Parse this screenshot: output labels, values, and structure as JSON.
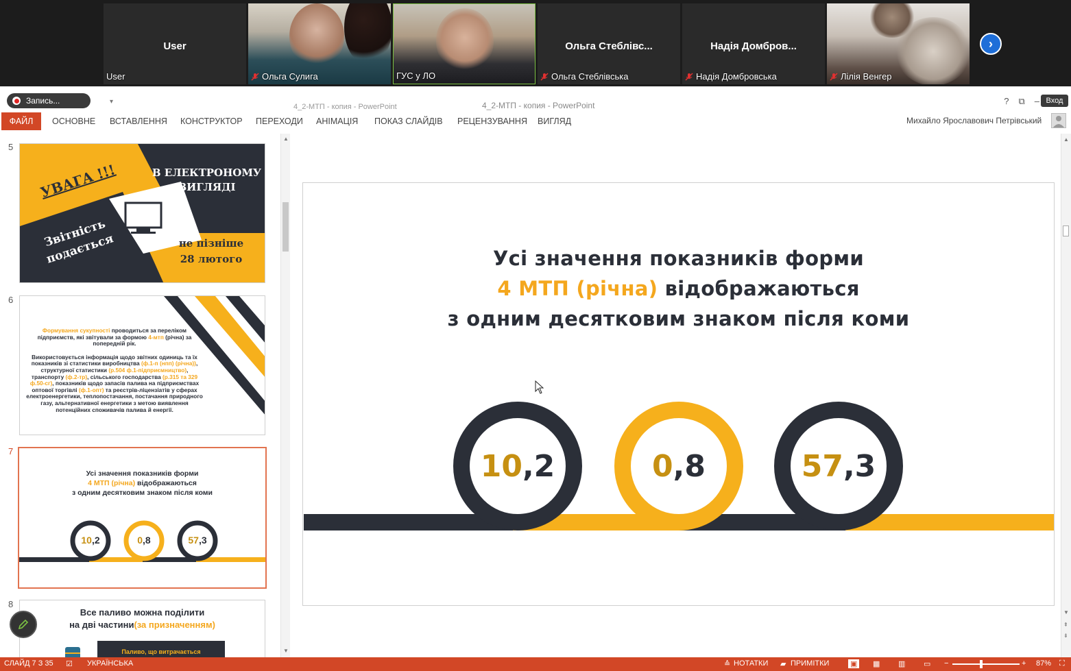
{
  "video_strip": {
    "participants": [
      {
        "center_name": "User",
        "bottom_name": "User",
        "muted": false,
        "video": false
      },
      {
        "center_name": "",
        "bottom_name": "Ольга Сулига",
        "muted": true,
        "video": true
      },
      {
        "center_name": "",
        "bottom_name": "ГУС у ЛО",
        "muted": false,
        "video": true
      },
      {
        "center_name": "Ольга  Стеблівс...",
        "bottom_name": "Ольга Стеблівська",
        "muted": true,
        "video": false
      },
      {
        "center_name": "Надія  Домбров...",
        "bottom_name": "Надія Домбровська",
        "muted": true,
        "video": false
      },
      {
        "center_name": "",
        "bottom_name": "Лілія Венгер",
        "muted": true,
        "video": true
      }
    ],
    "next_icon": "chevron-right-icon"
  },
  "titlebar": {
    "record_label": "Запись...",
    "doc_title_left": "4_2-МТП - копия - PowerPoint",
    "doc_title_center": "4_2-МТП - копия - PowerPoint",
    "login_label": "Вход",
    "help": "?"
  },
  "ribbon": {
    "file_tab": "ФАЙЛ",
    "tabs": [
      "ОСНОВНЕ",
      "ВСТАВЛЕННЯ",
      "КОНСТРУКТОР",
      "ПЕРЕХОДИ",
      "АНІМАЦІЯ",
      "ПОКАЗ СЛАЙДІВ",
      "РЕЦЕНЗУВАННЯ",
      "ВИГЛЯД"
    ],
    "user_name": "Михайло Ярославович Петрівський"
  },
  "thumbnails": {
    "numbers": [
      "5",
      "6",
      "7",
      "8"
    ],
    "slide5": {
      "attention": "УВАГА !!!",
      "electronic": "В ЕЛЕКТРОНОМУ ВИГЛЯДІ",
      "report": "Звітність подається",
      "deadline": "не пізніше 28 лютого"
    },
    "slide6": {
      "p1_hl": "Формування сукупності",
      "p1_a": " проводиться за переліком підприємств, які звітували за формою ",
      "p1_hl2": "4-мтп",
      "p1_b": " (річна) за попередній рік.",
      "p2_a": "Використовується інформація щодо звітних одиниць та їх показників зі статистики виробництва ",
      "p2_hl1": "(ф.1-п (нпп) (річна))",
      "p2_b": ", структурної статистики ",
      "p2_hl2": "(р.504 ф.1-підприємництво)",
      "p2_c": ", транспорту ",
      "p2_hl3": "(ф.2-тр)",
      "p2_d": ", сільського господарства ",
      "p2_hl4": "(р.315 та 329 ф.50-сг)",
      "p2_e": ", показників щодо запасів палива на підприємствах оптової торгівлі ",
      "p2_hl5": "(ф.1-опт)",
      "p2_f": " та реєстрів-ліцензіатів у сферах електроенергетики, теплопостачання, постачання природного газу, альтернативної енергетики з метою виявлення потенційних споживачів палива й енергії."
    },
    "slide8": {
      "title_a": "Все паливо можна поділити",
      "title_b": "на дві частини",
      "title_hl": "(за призначенням)",
      "box_text": "Паливо, що витрачається"
    }
  },
  "slide": {
    "line1": "Усі значення показників форми",
    "line2_hl": "4 МТП (річна)",
    "line2_rest": " відображаються",
    "line3": "з одним десятковим знаком після коми",
    "values": [
      {
        "int": "10",
        "frac": ",2",
        "ring_color": "#2b2f38"
      },
      {
        "int": "0",
        "frac": ",8",
        "ring_color": "#f4b01e"
      },
      {
        "int": "57",
        "frac": ",3",
        "ring_color": "#2b2f38"
      }
    ],
    "dark": "#2b2f38",
    "accent": "#f4b01e"
  },
  "statusbar": {
    "slide_info": "СЛАЙД 7 З 35",
    "language": "УКРАЇНСЬКА",
    "notes": "НОТАТКИ",
    "comments": "ПРИМІТКИ",
    "zoom": "87%",
    "zoom_minus": "−",
    "zoom_plus": "+"
  }
}
